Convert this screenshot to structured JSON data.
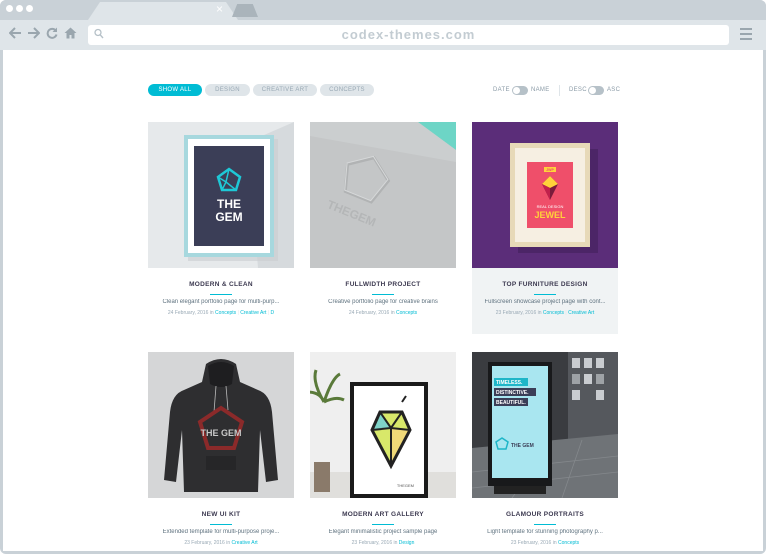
{
  "browser": {
    "url": "codex-themes.com",
    "tab_close_glyph": "×",
    "back_icon": "arrow-left-icon",
    "forward_icon": "arrow-right-icon",
    "reload_icon": "reload-icon",
    "home_icon": "home-icon"
  },
  "filters": [
    "SHOW ALL",
    "DESIGN",
    "CREATIVE ART",
    "CONCEPTS"
  ],
  "sorting": {
    "left_a": "DATE",
    "left_b": "NAME",
    "right_a": "DESC",
    "right_b": "ASC"
  },
  "colors": {
    "accent": "#00bcd4",
    "purple": "#5b2d79",
    "teal": "#6dd5c6"
  },
  "cards": [
    {
      "title": "MODERN & CLEAN",
      "desc": "Clean elegant portfolio page for multi-purp...",
      "date": "24 February, 2016 in",
      "cats": [
        "Concepts",
        "Creative Art",
        "D"
      ],
      "shaded": false
    },
    {
      "title": "FULLWIDTH PROJECT",
      "desc": "Creative portfolio page for creative brains",
      "date": "24 February, 2016 in",
      "cats": [
        "Concepts"
      ],
      "shaded": false
    },
    {
      "title": "TOP FURNITURE DESIGN",
      "desc": "Fullscreen showcase project page with cont...",
      "date": "23 February, 2016 in",
      "cats": [
        "Concepts",
        "Creative Art"
      ],
      "shaded": true
    },
    {
      "title": "NEW UI KIT",
      "desc": "Extended template for multi-purpose proje...",
      "date": "23 February, 2016 in",
      "cats": [
        "Creative Art"
      ],
      "shaded": false
    },
    {
      "title": "MODERN ART GALLERY",
      "desc": "Elegant minimalistic project sample page",
      "date": "23 February, 2016 in",
      "cats": [
        "Design"
      ],
      "shaded": false
    },
    {
      "title": "GLAMOUR PORTRAITS",
      "desc": "Light template for stunning photography p...",
      "date": "23 February, 2016 in",
      "cats": [
        "Concepts"
      ],
      "shaded": false
    }
  ],
  "art": {
    "gem_poster_line1": "THE",
    "gem_poster_line2": "GEM",
    "emboss_text": "THEGEM",
    "jewel_badge": "JWP",
    "jewel_sub": "REAL DESIGN",
    "jewel_title": "JEWEL",
    "hoodie_text": "THE GEM",
    "gallery_logo": "THEGEM",
    "billboard_1": "TIMELESS.",
    "billboard_2": "DISTINCTIVE.",
    "billboard_3": "BEAUTIFUL.",
    "billboard_logo": "THE GEM"
  }
}
